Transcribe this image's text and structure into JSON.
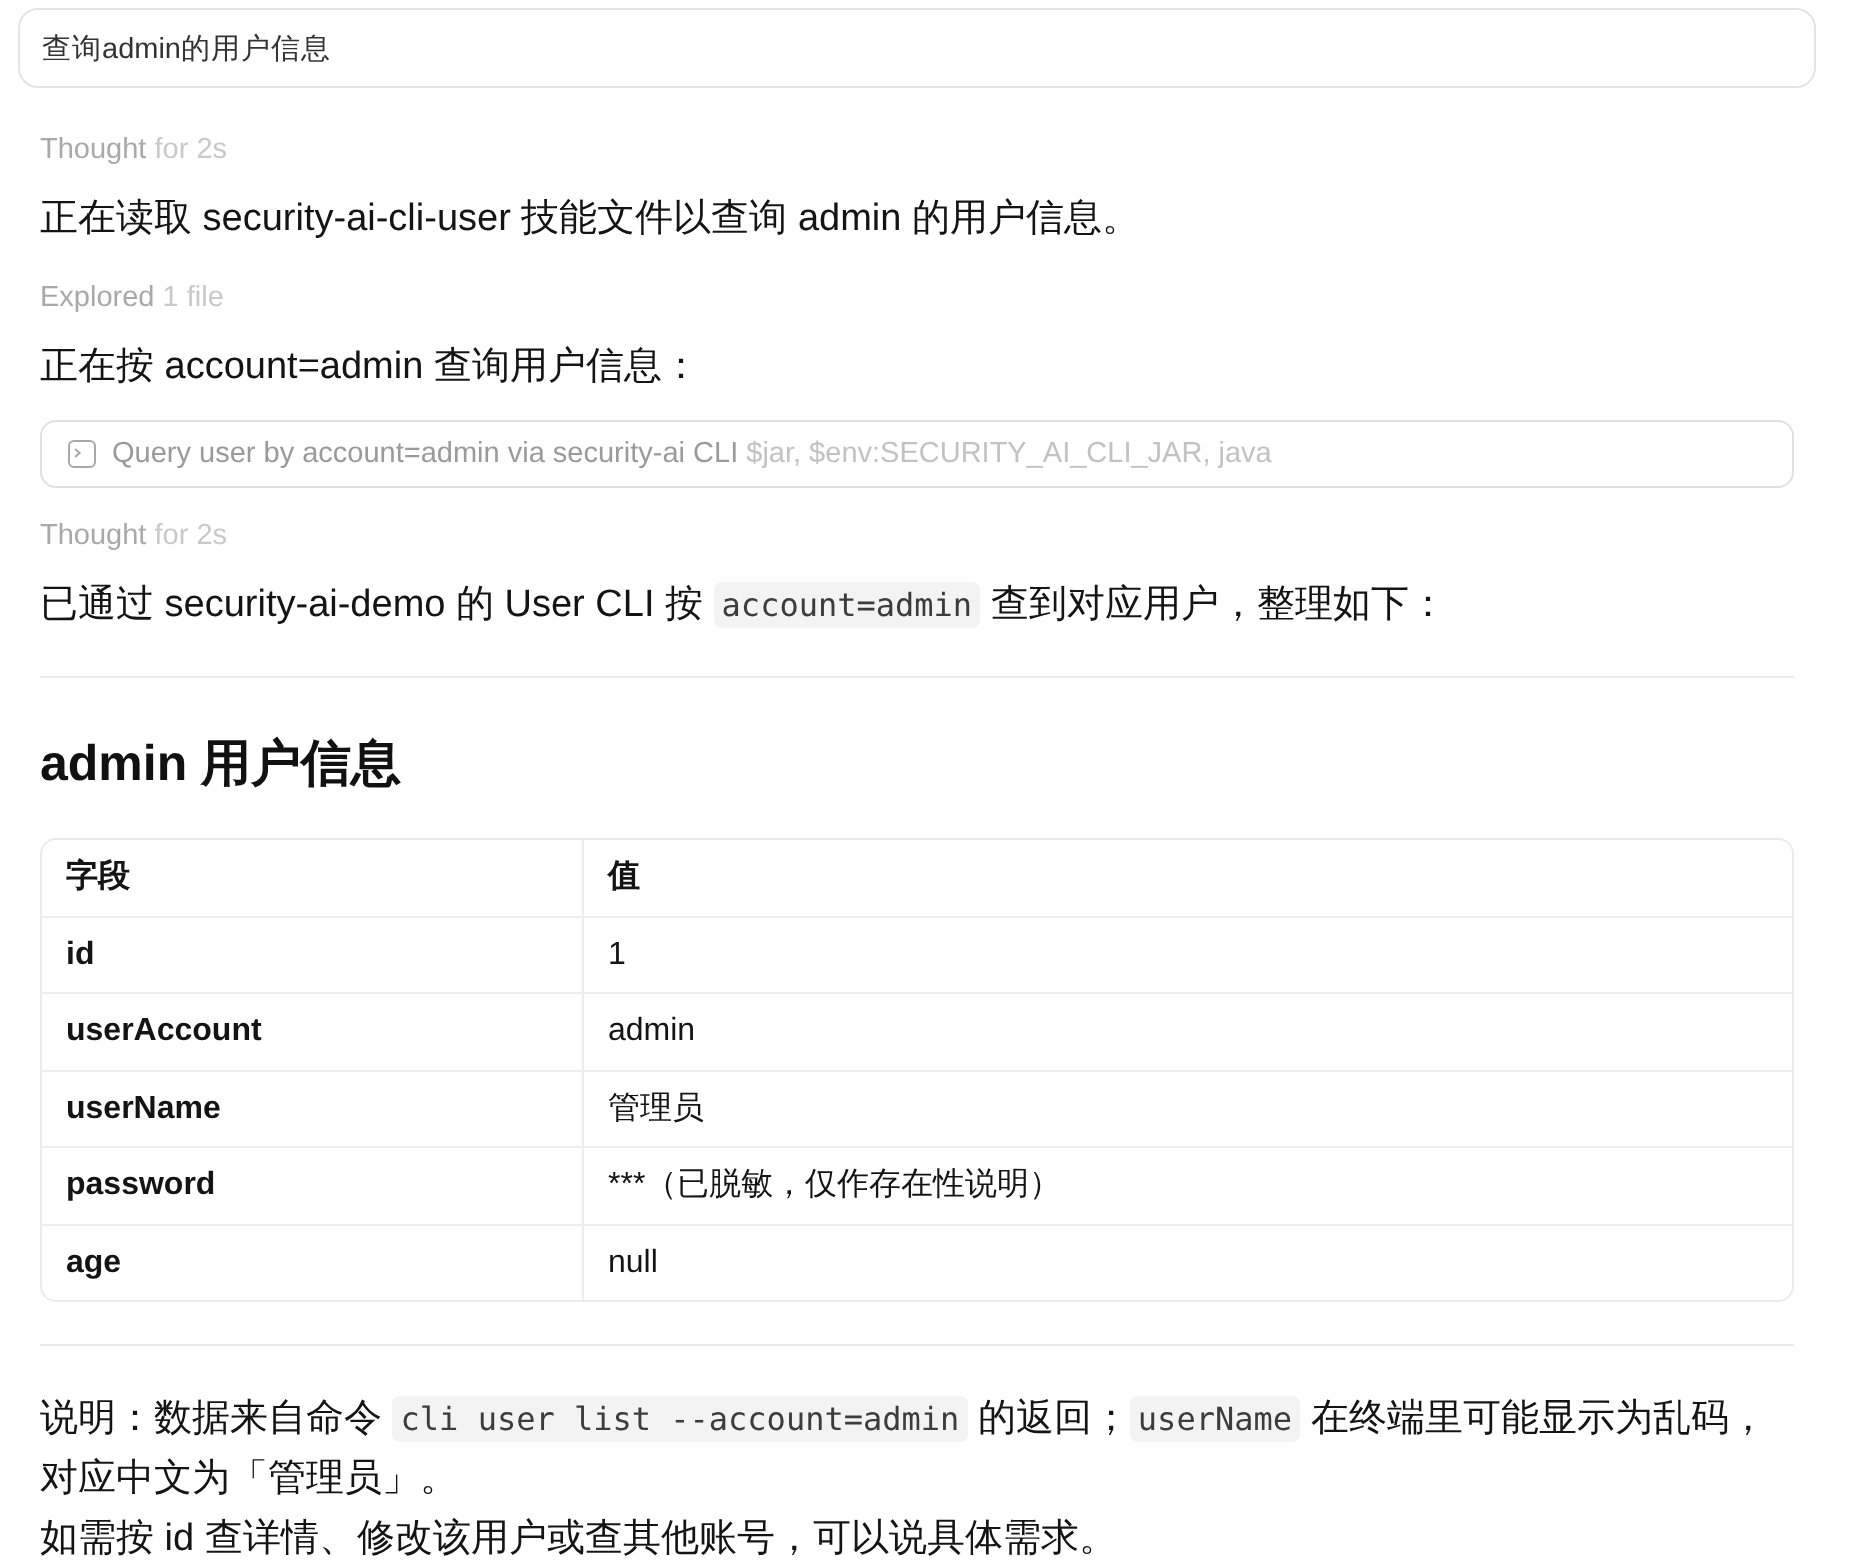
{
  "prompt": {
    "text": "查询admin的用户信息"
  },
  "transcript": [
    {
      "kind": "status",
      "label": "Thought",
      "detail": "for 2s"
    },
    {
      "kind": "message",
      "segments": [
        {
          "kind": "text",
          "text": "正在读取 security-ai-cli-user 技能文件以查询 admin 的用户信息。"
        }
      ]
    },
    {
      "kind": "status",
      "label": "Explored",
      "detail": "1 file"
    },
    {
      "kind": "message",
      "segments": [
        {
          "kind": "text",
          "text": "正在按 account=admin 查询用户信息："
        }
      ]
    },
    {
      "kind": "command",
      "text": "Query user by account=admin via security-ai CLI",
      "detail": "$jar, $env:SECURITY_AI_CLI_JAR, java"
    },
    {
      "kind": "status",
      "label": "Thought",
      "detail": "for 2s"
    },
    {
      "kind": "message",
      "segments": [
        {
          "kind": "text",
          "text": "已通过 security-ai-demo 的 User CLI 按 "
        },
        {
          "kind": "code",
          "text": "account=admin"
        },
        {
          "kind": "text",
          "text": " 查到对应用户，整理如下："
        }
      ]
    },
    {
      "kind": "divider"
    },
    {
      "kind": "heading",
      "text": "admin 用户信息"
    },
    {
      "kind": "table",
      "columns": [
        "字段",
        "值"
      ],
      "rows": [
        [
          "id",
          "1"
        ],
        [
          "userAccount",
          "admin"
        ],
        [
          "userName",
          "管理员"
        ],
        [
          "password",
          "***（已脱敏，仅作存在性说明）"
        ],
        [
          "age",
          "null"
        ]
      ]
    },
    {
      "kind": "divider"
    },
    {
      "kind": "message",
      "segments": [
        {
          "kind": "text",
          "text": "说明：数据来自命令 "
        },
        {
          "kind": "code",
          "text": "cli user list --account=admin"
        },
        {
          "kind": "text",
          "text": " 的返回；"
        },
        {
          "kind": "code",
          "text": "userName"
        },
        {
          "kind": "text",
          "text": " 在终端里可能显示为乱码，对应中文为「管理员」。"
        }
      ]
    },
    {
      "kind": "message",
      "segments": [
        {
          "kind": "text",
          "text": "如需按 id 查详情、修改该用户或查其他账号，可以说具体需求。"
        }
      ]
    }
  ]
}
